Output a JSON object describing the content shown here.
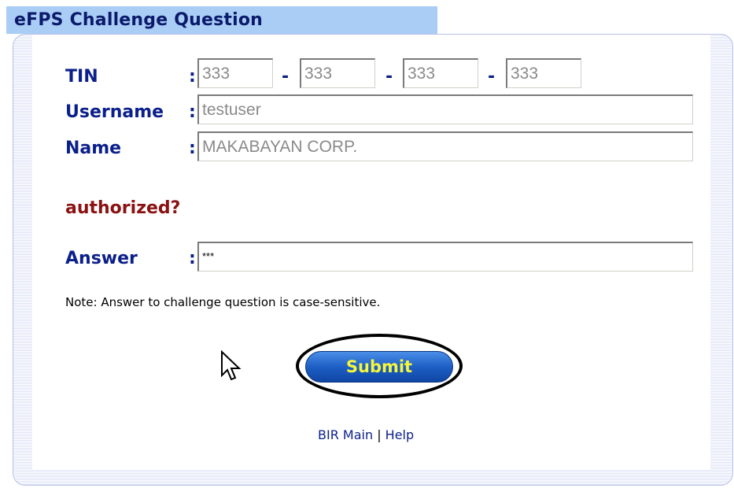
{
  "title": "eFPS Challenge Question",
  "form": {
    "tin_label": "TIN",
    "username_label": "Username",
    "name_label": "Name",
    "colon": ":",
    "dash": "-",
    "tin_values": [
      "333",
      "333",
      "333",
      "333"
    ],
    "username_value": "testuser",
    "name_value": "MAKABAYAN CORP.",
    "challenge_question": "authorized?",
    "answer_label": "Answer",
    "answer_value": "***",
    "note": "Note: Answer to challenge question is case-sensitive."
  },
  "actions": {
    "submit_label": "Submit"
  },
  "footer": {
    "bir_main_label": "BIR Main",
    "separator": "|",
    "help_label": "Help"
  },
  "colors": {
    "title_bar_bg": "#a9cdf5",
    "label_color": "#0b1f8a",
    "question_color": "#8b1212",
    "submit_text": "#f6f63a",
    "submit_bg": "#1d5fc4"
  },
  "icons": {
    "cursor": "mouse-pointer-icon"
  }
}
